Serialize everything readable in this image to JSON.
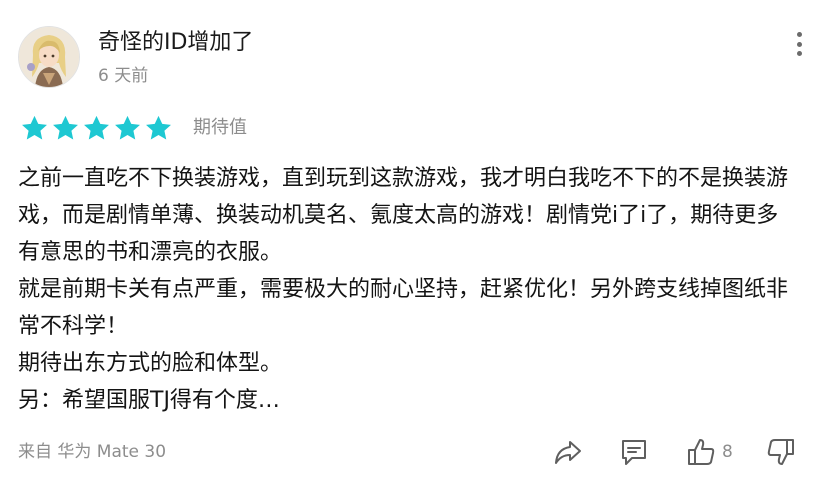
{
  "review": {
    "username": "奇怪的ID增加了",
    "time_ago": "6 天前",
    "rating": 5,
    "rating_max": 5,
    "rating_label": "期待值",
    "star_color": "#1ec8d2",
    "paragraphs": [
      "之前一直吃不下换装游戏，直到玩到这款游戏，我才明白我吃不下的不是换装游戏，而是剧情单薄、换装动机莫名、氪度太高的游戏！剧情党i了i了，期待更多有意思的书和漂亮的衣服。",
      "就是前期卡关有点严重，需要极大的耐心坚持，赶紧优化！另外跨支线掉图纸非常不科学！",
      "期待出东方式的脸和体型。",
      "另：希望国服TJ得有个度…"
    ],
    "device": "来自 华为 Mate 30",
    "like_count": "8"
  },
  "icons": {
    "more": "more-vertical-icon",
    "share": "share-icon",
    "comment": "comment-icon",
    "like": "thumbs-up-icon",
    "dislike": "thumbs-down-icon"
  }
}
